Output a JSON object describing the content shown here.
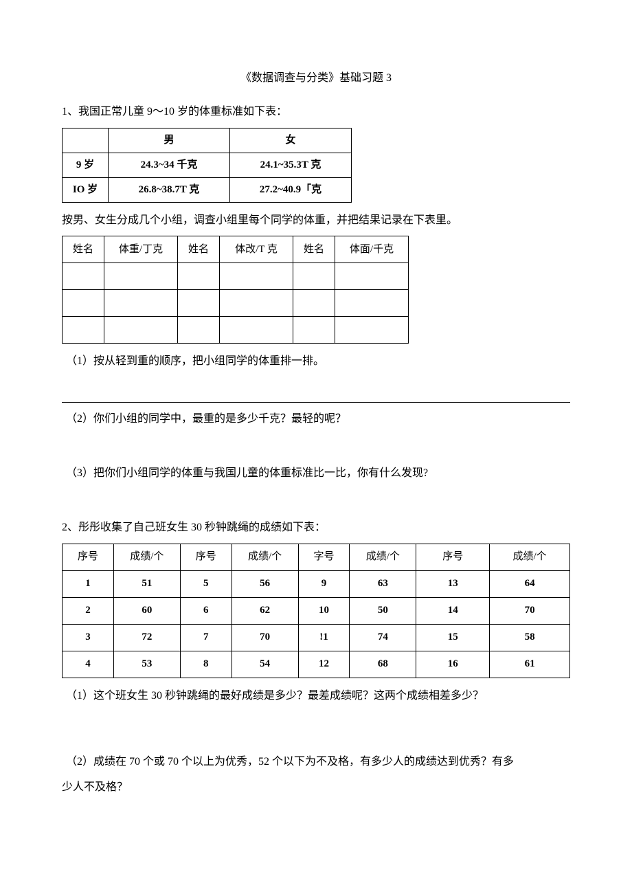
{
  "title": "《数据调查与分类》基础习题 3",
  "q1": {
    "intro": "1、我国正常儿童 9～10 岁的体重标准如下表：",
    "table": {
      "headers": [
        "",
        "男",
        "女"
      ],
      "rows": [
        [
          "9 岁",
          "24.3~34 千克",
          "24.1~35.3T 克"
        ],
        [
          "IO 岁",
          "26.8~38.7T 克",
          "27.2~40.9「克"
        ]
      ]
    },
    "instr": "按男、女生分成几个小组，调查小组里每个同学的体重，并把结果记录在下表里。",
    "blank_headers": [
      "姓名",
      "体重/丁克",
      "姓名",
      "体改/T 克",
      "姓名",
      "体面/千克"
    ],
    "sub1": "（1）按从轻到重的顺序，把小组同学的体重排一排。",
    "sub2": "（2）你们小组的同学中，最重的是多少千克？最轻的呢？",
    "sub3": "（3）把你们小组同学的体重与我国儿童的体重标准比一比，你有什么发现?"
  },
  "q2": {
    "intro": "2、彤彤收集了自己班女生 30 秒钟跳绳的成绩如下表：",
    "headers": [
      "序号",
      "成绩/个",
      "序号",
      "成绩/个",
      "字号",
      "成绩/个",
      "序号",
      "成绩/个"
    ],
    "rows": [
      [
        "1",
        "51",
        "5",
        "56",
        "9",
        "63",
        "13",
        "64"
      ],
      [
        "2",
        "60",
        "6",
        "62",
        "10",
        "50",
        "14",
        "70"
      ],
      [
        "3",
        "72",
        "7",
        "70",
        "!1",
        "74",
        "15",
        "58"
      ],
      [
        "4",
        "53",
        "8",
        "54",
        "12",
        "68",
        "16",
        "61"
      ]
    ],
    "sub1": "（1）这个班女生 30 秒钟跳绳的最好成绩是多少？最差成绩呢？这两个成绩相差多少？",
    "sub2a": "（2）成绩在 70 个或 70 个以上为优秀，52 个以下为不及格，有多少人的成绩达到优秀？有多",
    "sub2b": "少人不及格？"
  }
}
